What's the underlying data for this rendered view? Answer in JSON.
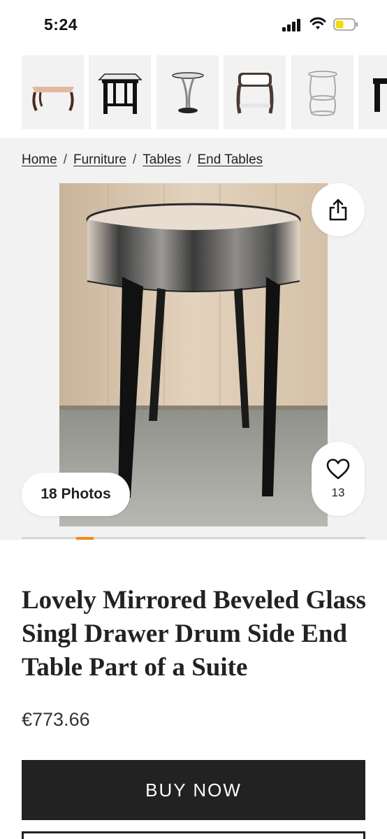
{
  "status_bar": {
    "time": "5:24"
  },
  "thumbnails": [
    {
      "icon": "coffee-table-icon"
    },
    {
      "icon": "octagonal-side-table-icon"
    },
    {
      "icon": "pedestal-table-icon"
    },
    {
      "icon": "drum-table-icon"
    },
    {
      "icon": "glass-side-table-icon"
    },
    {
      "icon": "partial-table-icon"
    }
  ],
  "breadcrumb": {
    "items": [
      "Home",
      "Furniture",
      "Tables",
      "End Tables"
    ],
    "separator": "/"
  },
  "gallery": {
    "photos_label": "18 Photos",
    "favorite_count": "13"
  },
  "product": {
    "title": "Lovely Mirrored Beveled Glass Singl Drawer Drum Side End Table Part of a Suite",
    "price": "€773.66"
  },
  "actions": {
    "buy_label": "BUY NOW"
  },
  "colors": {
    "accent": "#f08a1c",
    "button_dark": "#222222",
    "section_gray": "#f2f2f2"
  }
}
